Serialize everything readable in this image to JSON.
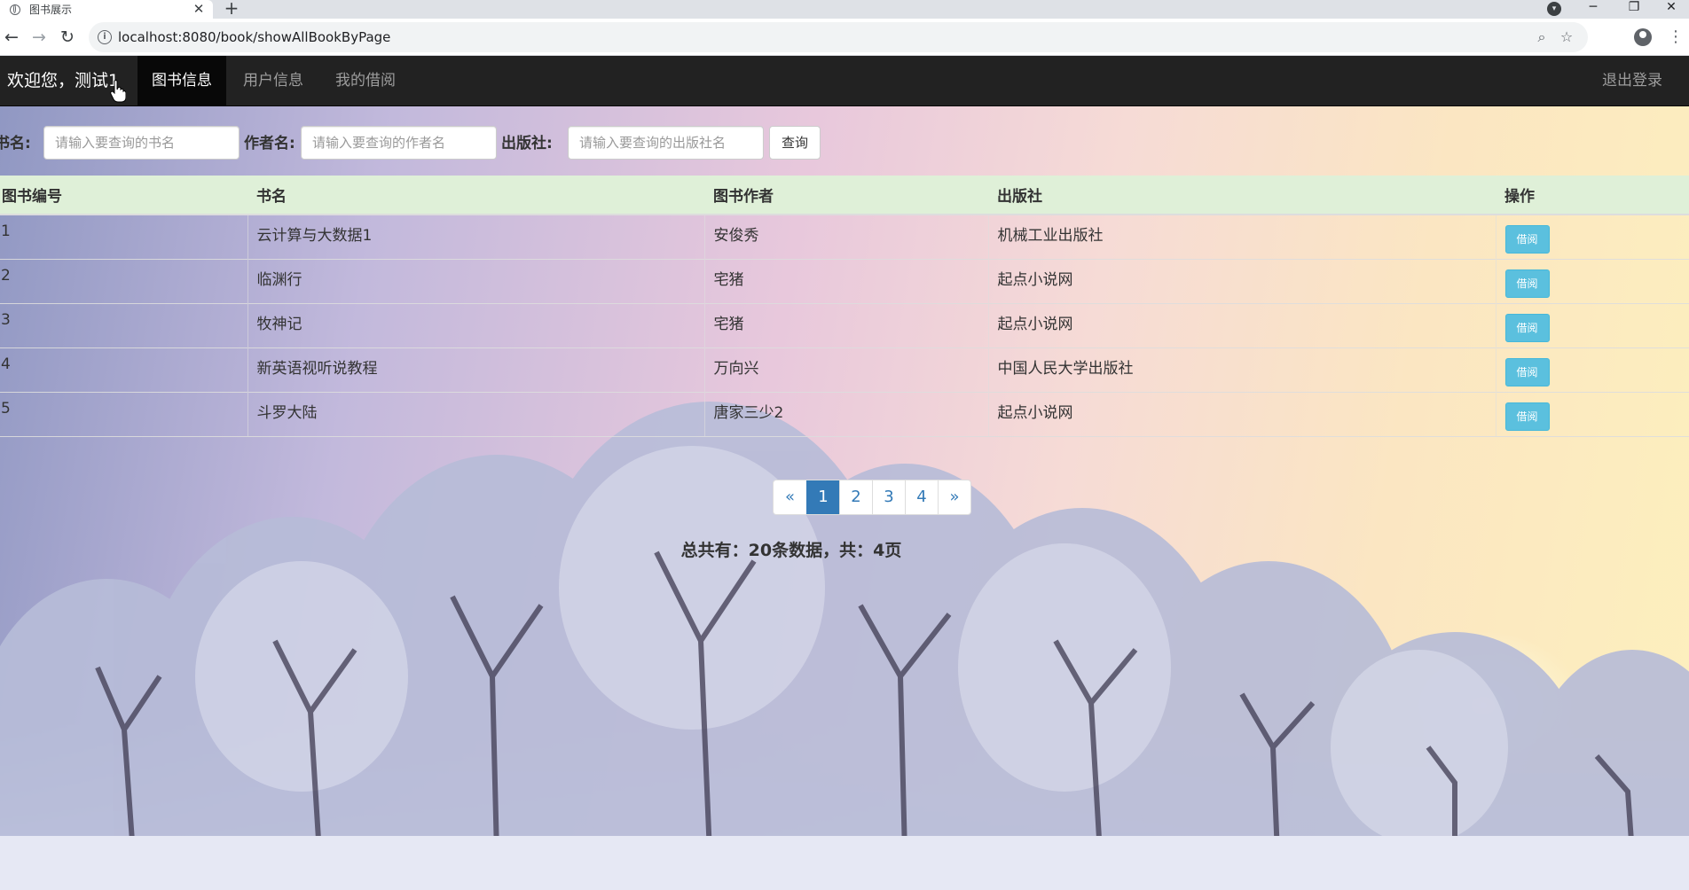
{
  "browser": {
    "tab_title": "图书展示",
    "tab_close": "✕",
    "new_tab": "+",
    "url": "localhost:8080/book/showAllBookByPage",
    "window_controls": {
      "minimize": "─",
      "restore": "❐",
      "close": "✕"
    }
  },
  "navbar": {
    "brand": "欢迎您，测试1",
    "items": [
      {
        "label": "图书信息",
        "active": true
      },
      {
        "label": "用户信息",
        "active": false
      },
      {
        "label": "我的借阅",
        "active": false
      }
    ],
    "logout": "退出登录"
  },
  "search": {
    "title_label": "书名:",
    "title_placeholder": "请输入要查询的书名",
    "author_label": "作者名:",
    "author_placeholder": "请输入要查询的作者名",
    "publisher_label": "出版社:",
    "publisher_placeholder": "请输入要查询的出版社名",
    "submit": "查询"
  },
  "table": {
    "headers": [
      "图书编号",
      "书名",
      "图书作者",
      "出版社",
      "操作"
    ],
    "rows": [
      {
        "id": "1",
        "title": "云计算与大数据1",
        "author": "安俊秀",
        "publisher": "机械工业出版社",
        "action": "借阅"
      },
      {
        "id": "2",
        "title": "临渊行",
        "author": "宅猪",
        "publisher": "起点小说网",
        "action": "借阅"
      },
      {
        "id": "3",
        "title": "牧神记",
        "author": "宅猪",
        "publisher": "起点小说网",
        "action": "借阅"
      },
      {
        "id": "4",
        "title": "新英语视听说教程",
        "author": "万向兴",
        "publisher": "中国人民大学出版社",
        "action": "借阅"
      },
      {
        "id": "5",
        "title": "斗罗大陆",
        "author": "唐家三少2",
        "publisher": "起点小说网",
        "action": "借阅"
      }
    ]
  },
  "pagination": {
    "prev": "«",
    "pages": [
      "1",
      "2",
      "3",
      "4"
    ],
    "current": "1",
    "next": "»"
  },
  "summary": "总共有：20条数据，共：4页",
  "colors": {
    "navbar_bg": "#222222",
    "nav_active_bg": "#080808",
    "header_row_bg": "#dff0d8",
    "info_button": "#5bc0de",
    "pagination_active": "#337ab7"
  }
}
